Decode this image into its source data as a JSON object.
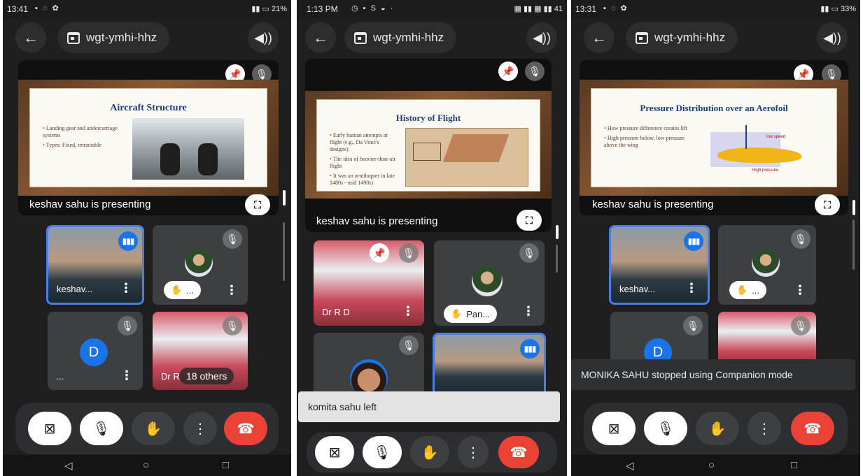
{
  "meeting": {
    "code": "wgt-ymhi-hhz"
  },
  "colors": {
    "accent": "#1a73e8",
    "end_call": "#ea4335",
    "speaking_border": "#4a7fe8"
  },
  "icons": [
    "back-arrow-icon",
    "calendar-icon",
    "speaker-icon",
    "pin-icon",
    "mic-off-icon",
    "fullscreen-icon",
    "hand-raise-icon",
    "more-vert-icon",
    "camera-off-icon",
    "end-call-icon"
  ],
  "screens": [
    {
      "status": {
        "time": "13:41",
        "battery": "21%"
      },
      "presenting": "keshav sahu is presenting",
      "slide": {
        "title": "Aircraft Structure",
        "bullets": [
          "Landing gear and undercarriage systems",
          "Types: Fixed, retractable"
        ]
      },
      "tiles": [
        {
          "name": "keshav..."
        },
        {
          "hand": "..."
        },
        {
          "avatar": "D",
          "name": "..."
        },
        {
          "name": "Dr R",
          "overlay": "18 others"
        }
      ]
    },
    {
      "status": {
        "time": "1:13 PM",
        "battery": "41"
      },
      "presenting": "keshav sahu is presenting",
      "slide": {
        "title": "History of Flight",
        "bullets": [
          "Early human attempts at flight (e.g., Da Vinci's designs)",
          "The idea of heavier-than-air flight",
          "It was an ornithopter in late 1480s - mid 1490s)"
        ]
      },
      "tiles": [
        {
          "name": "Dr R D"
        },
        {
          "hand": "Pan..."
        }
      ],
      "toast": "komita sahu left"
    },
    {
      "status": {
        "time": "13:31",
        "battery": "33%"
      },
      "presenting": "keshav sahu is presenting",
      "slide": {
        "title": "Pressure Distribution over an Aerofoil",
        "bullets": [
          "How pressure difference creates lift",
          "High pressure below, low pressure above the wing"
        ],
        "labels": [
          "low speed",
          "High pressure"
        ]
      },
      "tiles": [
        {
          "name": "keshav..."
        },
        {
          "hand": "..."
        },
        {
          "avatar": "D"
        }
      ],
      "toast": "MONIKA SAHU stopped using Companion mode"
    }
  ]
}
